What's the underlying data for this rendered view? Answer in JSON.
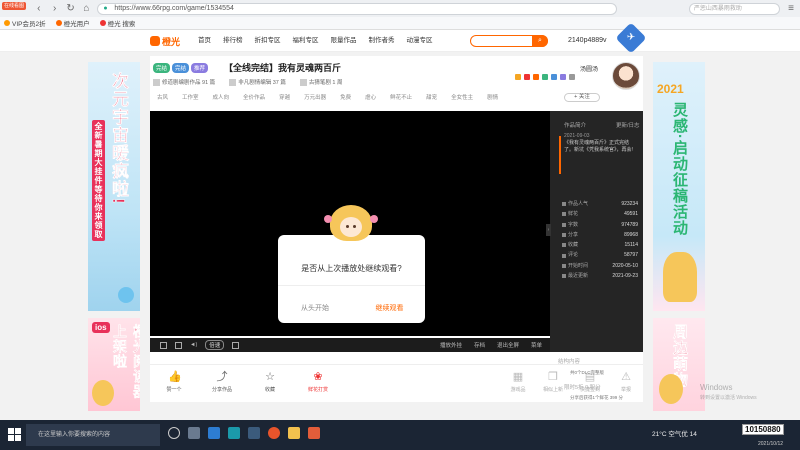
{
  "browser": {
    "tab_badge": "在线看图",
    "url": "https://www.66rpg.com/game/1534554",
    "search_placeholder": "严惩山西暴雨救助",
    "bookmarks": [
      "VIP会员2折",
      "橙光用户",
      "橙光 搜索"
    ]
  },
  "site": {
    "logo": "橙光",
    "nav": [
      "首页",
      "排行榜",
      "折扣专区",
      "福利专区",
      "限量作品",
      "制作者秀",
      "动漫专区"
    ],
    "user": "2140p4889v"
  },
  "game": {
    "tags": [
      "完结",
      "完结",
      "推荐"
    ],
    "title": "【全线完结】我有灵魂两百斤",
    "meta": [
      "修道剧编剧作品 91 篇",
      "非凡剧情编辑 37 篇",
      "古猜笔剧 1 周"
    ],
    "categories": [
      "古风",
      "工作室",
      "成人向",
      "全价作品",
      "穿越",
      "万元出器",
      "免费",
      "虐心",
      "鲜花不止",
      "甜宠",
      "全女性主",
      "剧情"
    ],
    "author": "汤圆汤",
    "follow": "+ 关注"
  },
  "dialog": {
    "question": "是否从上次播放处继续观看?",
    "restart": "从头开始",
    "continue": "继续观看"
  },
  "info_panel": {
    "tab": "作品简介",
    "link": "更新/日志",
    "news_date": "2021-09-03",
    "news_text": "《我有灵魂两百斤》正式完结了。新坑《凭我系统官》，再会!",
    "stats": [
      {
        "label": "作品人气",
        "value": "923234"
      },
      {
        "label": "鲜花",
        "value": "49591"
      },
      {
        "label": "字数",
        "value": "974789"
      },
      {
        "label": "分享",
        "value": "89968"
      },
      {
        "label": "收藏",
        "value": "15114"
      },
      {
        "label": "评论",
        "value": "58797"
      },
      {
        "label": "开始时间",
        "value": "2020-05-10"
      },
      {
        "label": "最近更新",
        "value": "2021-09-23"
      }
    ],
    "ext1": "结构内容",
    "ext1_sub": "共0个DLC完整版",
    "ext2": "限时5折 0 积分",
    "ext2_sub": "分享后获得1个鲜花 399 分"
  },
  "player_controls": {
    "speed": "倍速",
    "right": [
      "播放外挂",
      "存档",
      "退出全屏",
      "菜单"
    ]
  },
  "actions": {
    "items": [
      "赞一个",
      "分享作品",
      "收藏",
      "鲜花打赏",
      "游戏品",
      "相似上新",
      "快捷签到",
      "举报"
    ]
  },
  "banners": {
    "left_top": "次元宇宙暖疯啦!",
    "left_top_sub": "全新暑期大挂件等待你来领取",
    "left_bot_tag": "ios",
    "left_bot": "橙光阅读器上架啦",
    "right_top": "2021",
    "right_top_main": "灵感·启动征稿活动",
    "right_bot": "周边萌物"
  },
  "taskbar": {
    "search_placeholder": "在这里输入你要搜索的内容",
    "weather": "21°C 空气优 14",
    "time": "10:50",
    "date": "2021/10/12",
    "overlay": "10150880"
  },
  "watermark": {
    "line1": "Windows",
    "line2": "转到设置以激活 Windows"
  },
  "colors": {
    "accent": "#ff6600",
    "brand_blue": "#3a7bd5",
    "dark_panel": "#252525"
  }
}
